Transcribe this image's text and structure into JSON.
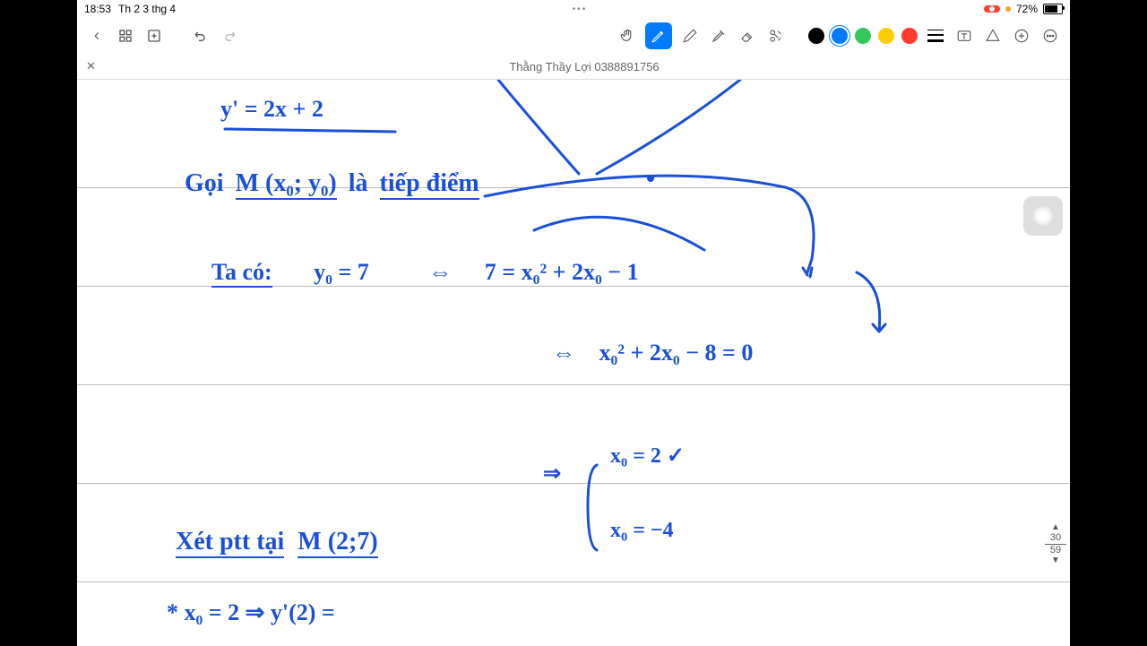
{
  "status": {
    "time": "18:53",
    "date": "Th 2 3 thg 4",
    "battery_pct": "72%",
    "rec": "REC"
  },
  "toolbar": {
    "colors": {
      "black": "#000000",
      "blue": "#007aff",
      "green": "#34c759",
      "yellow": "#ffcc00",
      "red": "#ff3b30"
    }
  },
  "doc": {
    "title": "Thằng Thầy Lợi 0388891756"
  },
  "page": {
    "current": "30",
    "total": "59"
  },
  "handwriting": {
    "line1": "y' = 2x + 2",
    "line2a": "Gọi",
    "line2b": "M (x₀; y₀)",
    "line2c": "là",
    "line2d": "tiếp điểm",
    "line3a": "Ta có:",
    "line3b": "y₀ = 7",
    "line3c": "⇔",
    "line3d": "7 = x₀² + 2x₀ − 1",
    "line4a": "⇔",
    "line4b": "x₀² + 2x₀ − 8 = 0",
    "line5a": "⇒",
    "line5b": "x₀ = 2 ✓",
    "line5c": "x₀ = −4",
    "line6a": "Xét ptt tại",
    "line6b": "M (2;7)",
    "line7a": "* x₀ = 2  ⇒  y'(2) ="
  }
}
